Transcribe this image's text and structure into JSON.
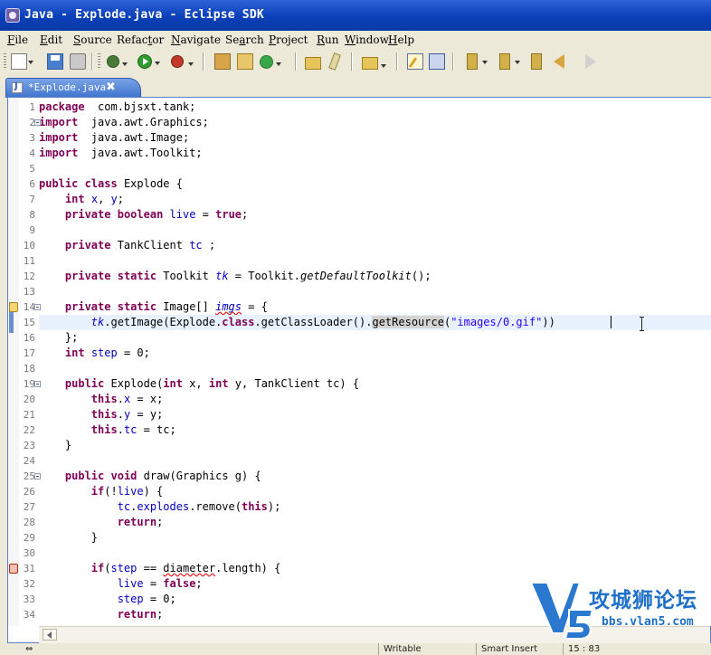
{
  "window": {
    "title": "Java - Explode.java - Eclipse SDK"
  },
  "menu": [
    {
      "mn": "F",
      "rest": "ile"
    },
    {
      "mn": "E",
      "rest": "dit"
    },
    {
      "mn": "S",
      "rest": "ource"
    },
    {
      "pre": "Refac",
      "mn": "t",
      "rest": "or"
    },
    {
      "mn": "N",
      "rest": "avigate"
    },
    {
      "pre": "Se",
      "mn": "a",
      "rest": "rch"
    },
    {
      "mn": "P",
      "rest": "roject"
    },
    {
      "mn": "R",
      "rest": "un"
    },
    {
      "mn": "W",
      "rest": "indow"
    },
    {
      "mn": "H",
      "rest": "elp"
    }
  ],
  "editor": {
    "tab_label": "*Explode.java",
    "tab_close": "✖",
    "current_line": 15,
    "line_numbers": [
      "1",
      "2",
      "3",
      "4",
      "5",
      "6",
      "7",
      "8",
      "9",
      "10",
      "11",
      "12",
      "13",
      "14",
      "15",
      "16",
      "17",
      "18",
      "19",
      "20",
      "21",
      "22",
      "23",
      "24",
      "25",
      "26",
      "27",
      "28",
      "29",
      "30",
      "31",
      "32",
      "33",
      "34"
    ],
    "lines": [
      [
        [
          "kw",
          "package"
        ],
        [
          "",
          "  com.bjsxt.tank;"
        ]
      ],
      [
        [
          "kw",
          "import"
        ],
        [
          "",
          "  java.awt.Graphics;"
        ]
      ],
      [
        [
          "kw",
          "import"
        ],
        [
          "",
          "  java.awt.Image;"
        ]
      ],
      [
        [
          "kw",
          "import"
        ],
        [
          "",
          "  java.awt.Toolkit;"
        ]
      ],
      [],
      [
        [
          "kw",
          "public"
        ],
        [
          "",
          " "
        ],
        [
          "kw",
          "class"
        ],
        [
          "",
          " Explode {"
        ]
      ],
      [
        [
          "",
          "    "
        ],
        [
          "kw",
          "int"
        ],
        [
          "",
          " "
        ],
        [
          "fld",
          "x"
        ],
        [
          "",
          ", "
        ],
        [
          "fld",
          "y"
        ],
        [
          "",
          ";"
        ]
      ],
      [
        [
          "",
          "    "
        ],
        [
          "kw",
          "private"
        ],
        [
          "",
          " "
        ],
        [
          "kw",
          "boolean"
        ],
        [
          "",
          " "
        ],
        [
          "fld",
          "live"
        ],
        [
          "",
          " = "
        ],
        [
          "kw",
          "true"
        ],
        [
          "",
          ";"
        ]
      ],
      [],
      [
        [
          "",
          "    "
        ],
        [
          "kw",
          "private"
        ],
        [
          "",
          " TankClient "
        ],
        [
          "fld",
          "tc"
        ],
        [
          "",
          " ;"
        ]
      ],
      [],
      [
        [
          "",
          "    "
        ],
        [
          "kw",
          "private"
        ],
        [
          "",
          " "
        ],
        [
          "kw",
          "static"
        ],
        [
          "",
          " Toolkit "
        ],
        [
          "stc",
          "tk"
        ],
        [
          "",
          " = Toolkit."
        ],
        [
          "ital",
          "getDefaultToolkit"
        ],
        [
          "",
          "();"
        ]
      ],
      [],
      [
        [
          "",
          "    "
        ],
        [
          "kw",
          "private"
        ],
        [
          "",
          " "
        ],
        [
          "kw",
          "static"
        ],
        [
          "",
          " Image[] "
        ],
        [
          "stc err",
          "imgs"
        ],
        [
          "",
          " = {"
        ]
      ],
      [
        [
          "",
          "        "
        ],
        [
          "stc",
          "tk"
        ],
        [
          "",
          ".getImage(Explode."
        ],
        [
          "kw",
          "class"
        ],
        [
          "",
          ".getClassLoader()."
        ],
        [
          "occ",
          "getResource"
        ],
        [
          "",
          "("
        ],
        [
          "str",
          "\"images/0.gif\""
        ],
        [
          "",
          "))"
        ]
      ],
      [
        [
          "",
          "    };"
        ]
      ],
      [
        [
          "",
          "    "
        ],
        [
          "kw",
          "int"
        ],
        [
          "",
          " "
        ],
        [
          "fld",
          "step"
        ],
        [
          "",
          " = 0;"
        ]
      ],
      [],
      [
        [
          "",
          "    "
        ],
        [
          "kw",
          "public"
        ],
        [
          "",
          " Explode("
        ],
        [
          "kw",
          "int"
        ],
        [
          "",
          " x, "
        ],
        [
          "kw",
          "int"
        ],
        [
          "",
          " y, TankClient tc) {"
        ]
      ],
      [
        [
          "",
          "        "
        ],
        [
          "kw",
          "this"
        ],
        [
          "",
          "."
        ],
        [
          "fld",
          "x"
        ],
        [
          "",
          " = x;"
        ]
      ],
      [
        [
          "",
          "        "
        ],
        [
          "kw",
          "this"
        ],
        [
          "",
          "."
        ],
        [
          "fld",
          "y"
        ],
        [
          "",
          " = y;"
        ]
      ],
      [
        [
          "",
          "        "
        ],
        [
          "kw",
          "this"
        ],
        [
          "",
          "."
        ],
        [
          "fld",
          "tc"
        ],
        [
          "",
          " = tc;"
        ]
      ],
      [
        [
          "",
          "    }"
        ]
      ],
      [],
      [
        [
          "",
          "    "
        ],
        [
          "kw",
          "public"
        ],
        [
          "",
          " "
        ],
        [
          "kw",
          "void"
        ],
        [
          "",
          " draw(Graphics g) {"
        ]
      ],
      [
        [
          "",
          "        "
        ],
        [
          "kw",
          "if"
        ],
        [
          "",
          "(!"
        ],
        [
          "fld",
          "live"
        ],
        [
          "",
          ") {"
        ]
      ],
      [
        [
          "",
          "            "
        ],
        [
          "fld",
          "tc"
        ],
        [
          "",
          "."
        ],
        [
          "fld",
          "explodes"
        ],
        [
          "",
          ".remove("
        ],
        [
          "kw",
          "this"
        ],
        [
          "",
          ");"
        ]
      ],
      [
        [
          "",
          "            "
        ],
        [
          "kw",
          "return"
        ],
        [
          "",
          ";"
        ]
      ],
      [
        [
          "",
          "        }"
        ]
      ],
      [],
      [
        [
          "",
          "        "
        ],
        [
          "kw",
          "if"
        ],
        [
          "",
          "("
        ],
        [
          "fld",
          "step"
        ],
        [
          "",
          " == "
        ],
        [
          "err",
          "diameter"
        ],
        [
          "",
          ".length) {"
        ]
      ],
      [
        [
          "",
          "            "
        ],
        [
          "fld",
          "live"
        ],
        [
          "",
          " = "
        ],
        [
          "kw",
          "false"
        ],
        [
          "",
          ";"
        ]
      ],
      [
        [
          "",
          "            "
        ],
        [
          "fld",
          "step"
        ],
        [
          "",
          " = 0;"
        ]
      ],
      [
        [
          "",
          "            "
        ],
        [
          "kw",
          "return"
        ],
        [
          "",
          ";"
        ]
      ]
    ]
  },
  "status": {
    "writable": "Writable",
    "insert_mode": "Smart Insert",
    "position": "15 : 83"
  },
  "watermark": {
    "logo": "V5",
    "text": "攻城狮论坛",
    "sub": "bbs.vlan5.com"
  }
}
